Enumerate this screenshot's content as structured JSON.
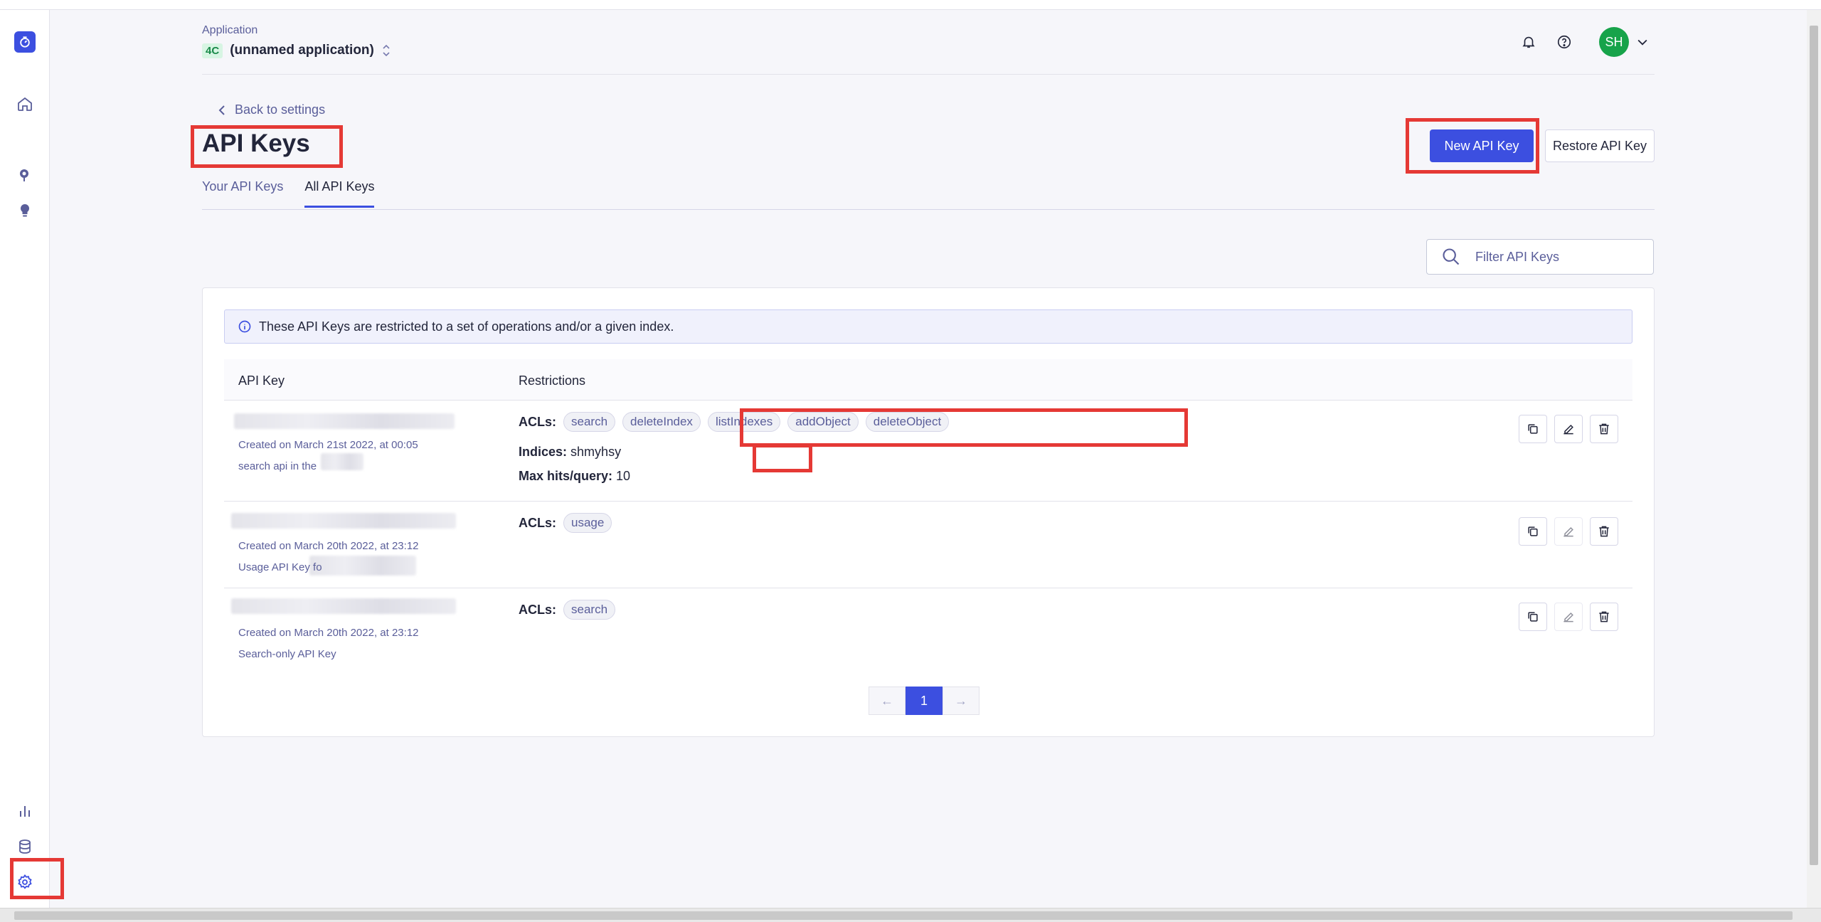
{
  "header": {
    "app_label": "Application",
    "app_badge": "4C",
    "app_name": "(unnamed application)",
    "avatar_initials": "SH"
  },
  "page": {
    "back_link": "Back to settings",
    "title": "API Keys",
    "new_key_button": "New API Key",
    "restore_key_button": "Restore API Key"
  },
  "tabs": [
    {
      "label": "Your API Keys",
      "active": false
    },
    {
      "label": "All API Keys",
      "active": true
    }
  ],
  "filter": {
    "placeholder": "Filter API Keys"
  },
  "info_banner": "These API Keys are restricted to a set of operations and/or a given index.",
  "table": {
    "columns": [
      "API Key",
      "Restrictions"
    ],
    "rows": [
      {
        "created": "Created on March 21st 2022, at 00:05",
        "description": "search api in the",
        "acl_label": "ACLs:",
        "acls": [
          "search",
          "deleteIndex",
          "listIndexes",
          "addObject",
          "deleteObject"
        ],
        "indices_label": "Indices:",
        "indices_value": "shmyhsy",
        "maxhits_label": "Max hits/query:",
        "maxhits_value": "10"
      },
      {
        "created": "Created on March 20th 2022, at 23:12",
        "description": "Usage API Key fo",
        "acl_label": "ACLs:",
        "acls": [
          "usage"
        ]
      },
      {
        "created": "Created on March 20th 2022, at 23:12",
        "description": "Search-only API Key",
        "acl_label": "ACLs:",
        "acls": [
          "search"
        ]
      }
    ]
  },
  "pagination": {
    "prev": "←",
    "current": "1",
    "next": "→"
  },
  "icons": {
    "sidebar": [
      "logo-icon",
      "home-icon",
      "search-insights-icon",
      "lightbulb-icon",
      "analytics-icon",
      "database-icon",
      "settings-icon"
    ],
    "header": [
      "bell-icon",
      "help-icon",
      "chevron-down-icon"
    ],
    "row_actions": [
      "copy-icon",
      "edit-icon",
      "delete-icon"
    ]
  },
  "colors": {
    "accent": "#3c4fe0",
    "avatar": "#17a34a",
    "highlight": "#e53935"
  }
}
